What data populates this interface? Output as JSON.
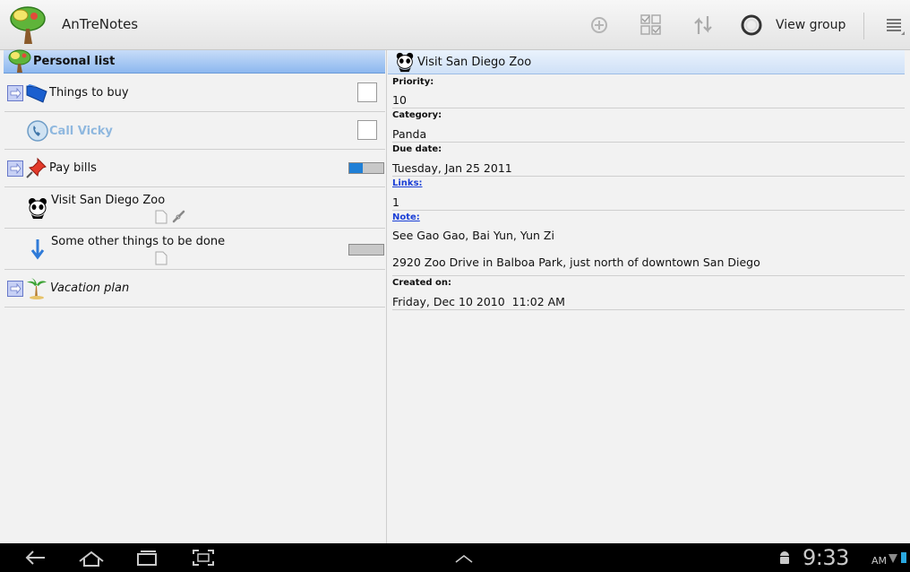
{
  "app": {
    "title": "AnTreNotes"
  },
  "actionbar": {
    "add_icon": "add-icon",
    "select_icon": "multi-select-icon",
    "sort_icon": "sort-icon",
    "view_group_label": "View group",
    "menu_icon": "menu-icon"
  },
  "list": {
    "header": "Personal list",
    "items": [
      {
        "label": "Things to buy",
        "icon": "folder-icon",
        "expandable": true,
        "control": "checkbox",
        "checked": false
      },
      {
        "label": "Call Vicky",
        "icon": "phone-icon",
        "expandable": false,
        "control": "checkbox",
        "checked": false,
        "color": "#8fb8df"
      },
      {
        "label": "Pay bills",
        "icon": "pin-icon",
        "expandable": true,
        "control": "progress",
        "progress_fraction": 0.4
      },
      {
        "label": "Visit San Diego Zoo",
        "icon": "panda-icon",
        "expandable": false,
        "control": "none",
        "has_note": true,
        "has_link": true
      },
      {
        "label": "Some other things to be done",
        "icon": "down-arrow-icon",
        "expandable": false,
        "control": "progress",
        "progress_fraction": 0.0,
        "has_note": true
      },
      {
        "label": "Vacation plan",
        "icon": "palm-tree-icon",
        "expandable": true,
        "control": "none",
        "italic": true
      }
    ]
  },
  "detail": {
    "title": "Visit San Diego Zoo",
    "fields": [
      {
        "label": "Priority:",
        "value": "10",
        "link": false
      },
      {
        "label": "Category:",
        "value": "Panda",
        "link": false
      },
      {
        "label": "Due date:",
        "value": "Tuesday, Jan 25 2011",
        "link": false
      },
      {
        "label": "Links:",
        "value": "1",
        "link": true
      },
      {
        "label": "Note:",
        "value": "See Gao Gao, Bai Yun, Yun Zi",
        "value2": "2920 Zoo Drive in Balboa Park, just north of downtown San Diego",
        "link": true
      },
      {
        "label": "Created on:",
        "value": "Friday, Dec 10 2010  11:02 AM",
        "link": false
      }
    ]
  },
  "system_bar": {
    "time": "9:33",
    "ampm": "AM"
  },
  "colors": {
    "accent": "#1f7fd6",
    "header_blue": "#8db8ef",
    "link": "#1a3fd6"
  }
}
